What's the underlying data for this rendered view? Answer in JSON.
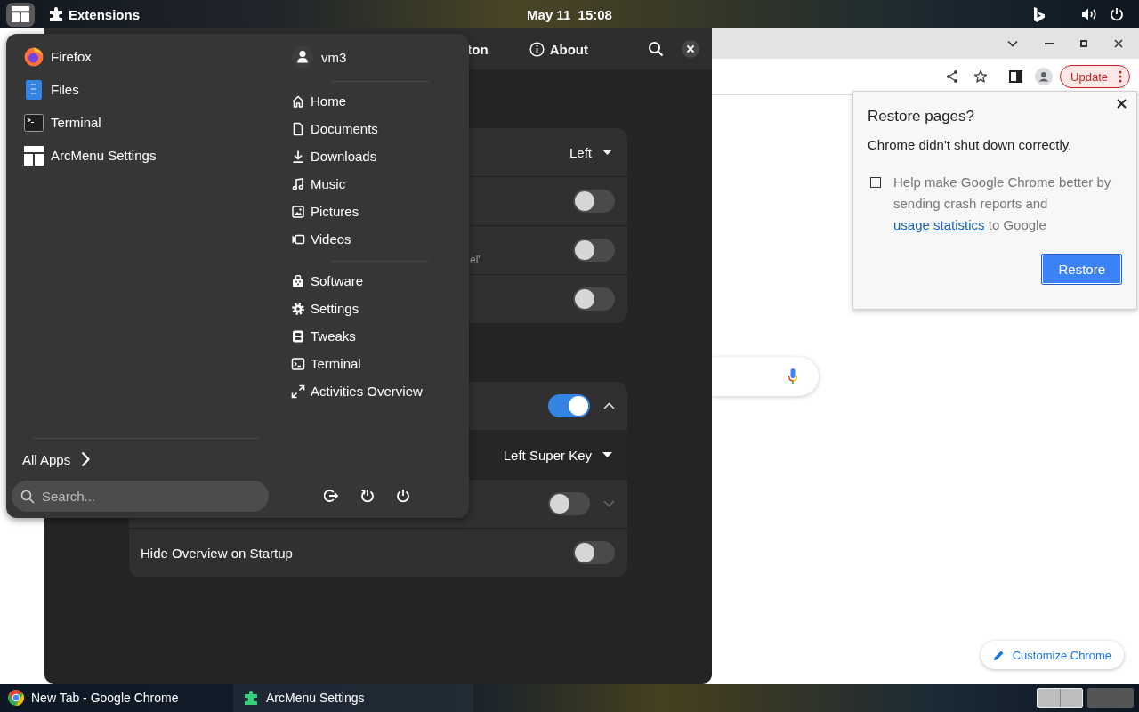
{
  "top_bar": {
    "app_menu": "Extensions",
    "clock": "May 11  15:08"
  },
  "chrome": {
    "update_label": "Update",
    "customize_label": "Customize Chrome",
    "restore_dialog": {
      "title": "Restore pages?",
      "message": "Chrome didn't shut down correctly.",
      "consent": {
        "checked": false,
        "text": "Help make Google Chrome better by sending crash reports and",
        "link": "usage statistics",
        "suffix": "to Google"
      },
      "button": "Restore"
    }
  },
  "settings_window": {
    "header_tabs": [
      {
        "label": "ton"
      },
      {
        "label": "About"
      }
    ],
    "groups": [
      {
        "rows": [
          {
            "kind": "dropdown",
            "value": "Left"
          },
          {
            "kind": "switch",
            "on": false
          },
          {
            "kind": "switch",
            "on": false,
            "subtitle": "el'"
          },
          {
            "kind": "switch",
            "on": false
          }
        ]
      },
      {
        "rows": [
          {
            "kind": "switch",
            "on": true,
            "expanded": true
          },
          {
            "kind": "subdropdown",
            "value": "Left Super Key"
          },
          {
            "kind": "switch",
            "on": false,
            "expanded": false
          },
          {
            "kind": "switch",
            "on": false,
            "title": "Hide Overview on Startup"
          }
        ]
      }
    ]
  },
  "arc_menu": {
    "apps": [
      {
        "name": "Firefox"
      },
      {
        "name": "Files"
      },
      {
        "name": "Terminal"
      },
      {
        "name": "ArcMenu Settings"
      }
    ],
    "all_apps": "All Apps",
    "search": {
      "placeholder": "Search..."
    },
    "user": "vm3",
    "places": [
      {
        "label": "Home"
      },
      {
        "label": "Documents"
      },
      {
        "label": "Downloads"
      },
      {
        "label": "Music"
      },
      {
        "label": "Pictures"
      },
      {
        "label": "Videos"
      }
    ],
    "system_items": [
      {
        "label": "Software"
      },
      {
        "label": "Settings"
      },
      {
        "label": "Tweaks"
      },
      {
        "label": "Terminal"
      },
      {
        "label": "Activities Overview"
      }
    ]
  },
  "taskbar": {
    "windows": [
      {
        "title": "New Tab - Google Chrome",
        "selected": false
      },
      {
        "title": "ArcMenu Settings",
        "selected": true
      }
    ],
    "workspaces": [
      {
        "selected": true
      },
      {
        "selected": false
      }
    ]
  }
}
